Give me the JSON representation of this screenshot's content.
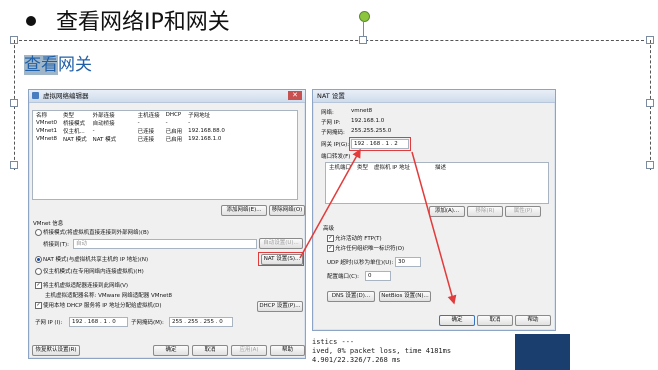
{
  "slide": {
    "title": "查看网络IP和网关",
    "subtitle_part1": "查看",
    "subtitle_part2": "网关"
  },
  "vne_dialog": {
    "title": "虚拟网络编辑器",
    "columns": [
      "名称",
      "类型",
      "外部连接",
      "主机连接",
      "DHCP",
      "子网地址"
    ],
    "rows": [
      [
        "VMnet0",
        "桥接模式",
        "自动桥接",
        "-",
        "-",
        "-"
      ],
      [
        "VMnet1",
        "仅主机...",
        "-",
        "已连接",
        "已启用",
        "192.168.88.0"
      ],
      [
        "VMnet8",
        "NAT 模式",
        "NAT 模式",
        "已连接",
        "已启用",
        "192.168.1.0"
      ]
    ],
    "add_network": "添加网络(E)...",
    "remove_network": "移除网络(O)",
    "vmnet_info": "VMnet 信息",
    "bridged_mode": "桥接模式(将虚拟机直接连接到外部网络)(B)",
    "bridged_to": "桥接到(T):",
    "bridged_value": "自动",
    "auto_settings": "自动设置(U)...",
    "nat_mode": "NAT 模式(与虚拟机共享主机的 IP 地址)(N)",
    "nat_settings": "NAT 设置(S)...",
    "host_only": "仅主机模式(在专用网络内连接虚拟机)(H)",
    "connect_host_adapter": "将主机虚拟适配器连接到此网络(V)",
    "host_adapter_name": "主机虚拟适配器名称: VMware 网络适配器 VMnet8",
    "use_dhcp": "使用本地 DHCP 服务将 IP 地址分配给虚拟机(D)",
    "dhcp_settings": "DHCP 设置(P)...",
    "subnet_ip_label": "子网 IP (I):",
    "subnet_ip": "192 . 168 . 1 . 0",
    "subnet_mask_label": "子网掩码(M):",
    "subnet_mask": "255 . 255 . 255 . 0",
    "restore_defaults": "恢复默认设置(R)",
    "ok": "确定",
    "cancel": "取消",
    "apply": "应用(A)",
    "help": "帮助"
  },
  "nat_dialog": {
    "title": "NAT 设置",
    "network_label": "网络:",
    "network_value": "vmnet8",
    "subnet_ip_label": "子网 IP:",
    "subnet_ip_value": "192.168.1.0",
    "subnet_mask_label": "子网掩码:",
    "subnet_mask_value": "255.255.255.0",
    "gateway_label": "网关 IP(G):",
    "gateway_value": "192 . 168 . 1 . 2",
    "port_forward_label": "端口转发(F)",
    "pf_columns": [
      "主机端口",
      "类型",
      "虚拟机 IP 地址",
      "描述"
    ],
    "add": "添加(A)...",
    "remove": "移除(R)",
    "properties": "属性(P)",
    "advanced": "高级",
    "allow_ftp": "允许活动的 FTP(T)",
    "allow_any_oui": "允许任何组织唯一标识符(O)",
    "udp_timeout_label": "UDP 超时(以秒为单位)(U):",
    "udp_timeout_value": "30",
    "config_port_label": "配置端口(C):",
    "config_port_value": "0",
    "dns_settings": "DNS 设置(D)...",
    "netbios_settings": "NetBios 设置(N)...",
    "ok": "确定",
    "cancel": "取消",
    "help": "帮助"
  },
  "terminal": {
    "line1": "istics ---",
    "line2": "ived, 0% packet loss, time 4181ms",
    "line3": "4.901/22.326/7.268 ms"
  },
  "colors": {
    "annotation_red": "#e23b3b",
    "subtitle_blue": "#1f5fa8",
    "dialog_bg": "#f0f0f0"
  }
}
